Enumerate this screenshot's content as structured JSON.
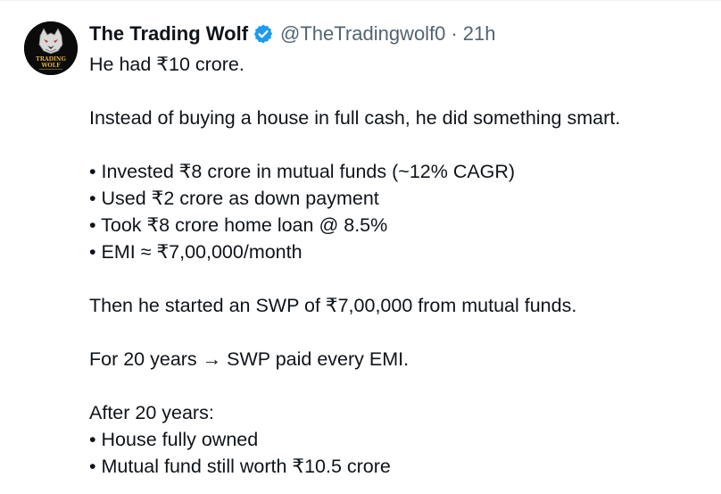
{
  "author": {
    "name": "The Trading Wolf",
    "handle": "@TheTradingwolf0",
    "separator": "·",
    "time": "21h",
    "avatar_text": [
      "TRADING",
      "WOLF"
    ],
    "verified_color": "#1d9bf0"
  },
  "tweet": {
    "line_1": "He had ₹10 crore.",
    "line_2": "Instead of buying a house in full cash, he did something smart.",
    "bullets_1": [
      "• Invested ₹8 crore in mutual funds (~12% CAGR)",
      "• Used ₹2 crore as down payment",
      "• Took ₹8 crore home loan @ 8.5%",
      "• EMI ≈ ₹7,00,000/month"
    ],
    "line_3": "Then he started an SWP of ₹7,00,000 from mutual funds.",
    "line_4": "For 20 years → SWP paid every EMI.",
    "line_5": "After 20 years:",
    "bullets_2": [
      "• House fully owned",
      "• Mutual fund still worth ₹10.5 crore"
    ]
  }
}
